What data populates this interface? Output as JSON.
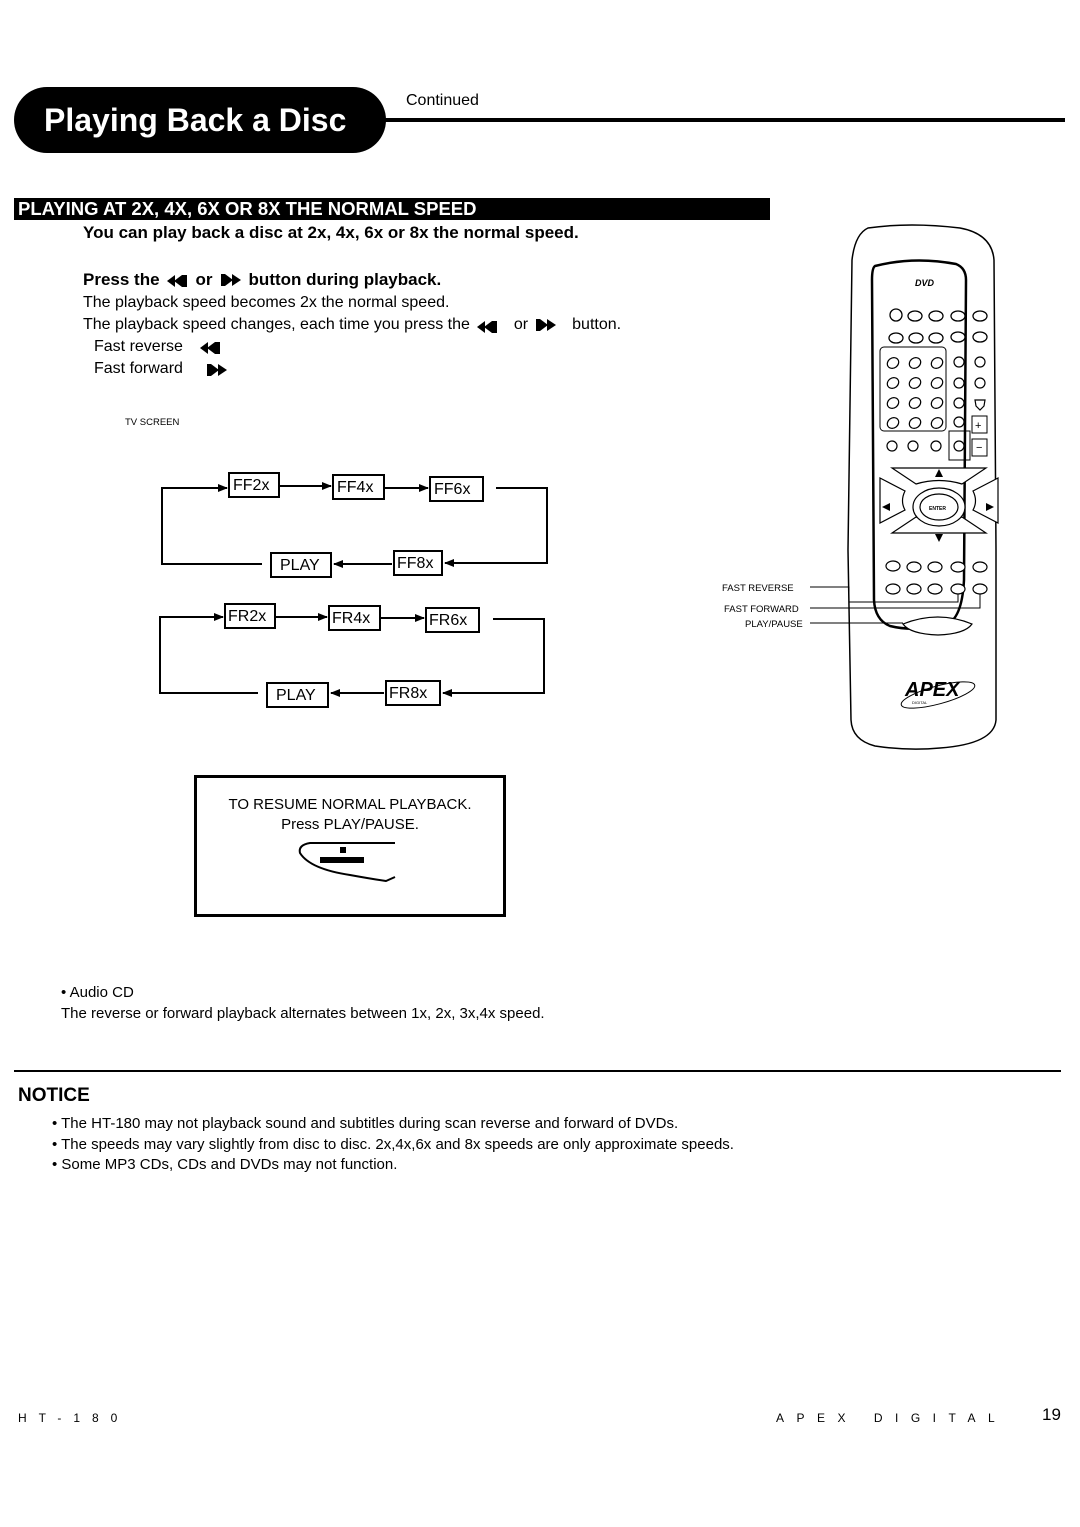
{
  "header": {
    "title": "Playing Back a Disc",
    "continued": "Continued"
  },
  "section": {
    "heading": "PLAYING AT 2X, 4X, 6X OR 8X THE NORMAL SPEED",
    "lead": "You can play back a disc at 2x, 4x, 6x or 8x the normal speed.",
    "press_prefix": "Press the",
    "press_or": "or",
    "press_suffix": "button during playback.",
    "line1": "The playback speed becomes 2x the normal speed.",
    "line2_prefix": "The playback speed changes, each time you press the",
    "line2_or": "or",
    "line2_suffix": "button.",
    "fast_reverse": "Fast reverse",
    "fast_forward": "Fast forward",
    "icons": {
      "reverse": "fast-reverse-icon",
      "forward": "fast-forward-icon"
    }
  },
  "tv_screen": {
    "label": "TV SCREEN",
    "ff_cycle": [
      "FF2x",
      "FF4x",
      "FF6x",
      "FF8x",
      "PLAY"
    ],
    "fr_cycle": [
      "FR2x",
      "FR4x",
      "FR6x",
      "FR8x",
      "PLAY"
    ]
  },
  "remote": {
    "callouts": [
      "FAST REVERSE",
      "FAST FORWARD",
      "PLAY/PAUSE"
    ],
    "brand": "APEX",
    "brand_sub": "DIGITAL",
    "nav_center": "ENTER",
    "logo": "DVD"
  },
  "resume_box": {
    "line1": "TO RESUME NORMAL PLAYBACK.",
    "line2": "Press PLAY/PAUSE.",
    "button_label": "PLAY/PAUSE"
  },
  "audio_cd": {
    "bullet": "• Audio CD",
    "text": "The reverse or forward playback alternates between 1x, 2x, 3x,4x speed."
  },
  "notice": {
    "heading": "NOTICE",
    "items": [
      "• The HT-180 may not playback sound and subtitles during scan reverse and forward of DVDs.",
      "• The speeds may vary slightly from disc to disc. 2x,4x,6x and 8x speeds are only approximate speeds.",
      "• Some MP3 CDs, CDs and  DVDs may not function."
    ]
  },
  "footer": {
    "model": "HT-180",
    "brand": "APEX DIGITAL",
    "page": "19"
  }
}
